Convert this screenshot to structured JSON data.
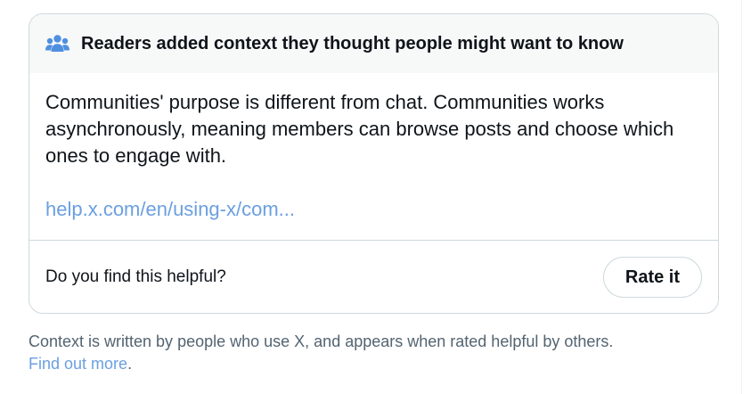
{
  "card": {
    "header_title": "Readers added context they thought people might want to know",
    "header_icon": "people-icon",
    "body_text": "Communities' purpose is different from chat. Communities works asynchronously, meaning members can browse posts and choose which ones to engage with.",
    "link_text": "help.x.com/en/using-x/com...",
    "question": "Do you find this helpful?",
    "rate_button_label": "Rate it"
  },
  "footnote": {
    "text": "Context is written by people who use X, and appears when rated helpful by others.",
    "link_text": "Find out more",
    "trailing": "."
  },
  "colors": {
    "accent_link": "#6b9fe0",
    "header_bg": "#f7f9f9",
    "border": "#cfd9de",
    "icon": "#1d9bf0"
  }
}
